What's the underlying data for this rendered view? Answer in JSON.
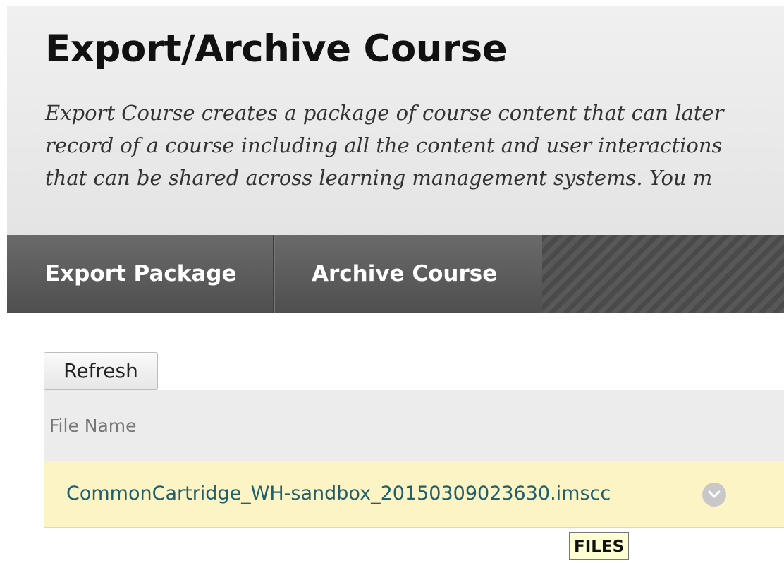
{
  "header": {
    "title": "Export/Archive Course",
    "description_lines": [
      "Export Course creates a package of course content that can later",
      "record of a course including all the content and user interactions",
      "that can be shared across learning management systems. You m"
    ]
  },
  "tabs": [
    {
      "label": "Export Package"
    },
    {
      "label": "Archive Course"
    }
  ],
  "toolbar": {
    "refresh_label": "Refresh"
  },
  "table": {
    "columns": [
      "File Name"
    ],
    "rows": [
      {
        "file_name": "CommonCartridge_WH-sandbox_20150309023630.imscc"
      }
    ]
  },
  "tooltip": {
    "text": "FILES"
  },
  "icons": {
    "row_menu": "chevron-down-icon"
  },
  "colors": {
    "tab_bar": "#505050",
    "row_highlight": "#fcf4c4",
    "link": "#1f5f6e",
    "tooltip_bg": "#ffffd4"
  }
}
